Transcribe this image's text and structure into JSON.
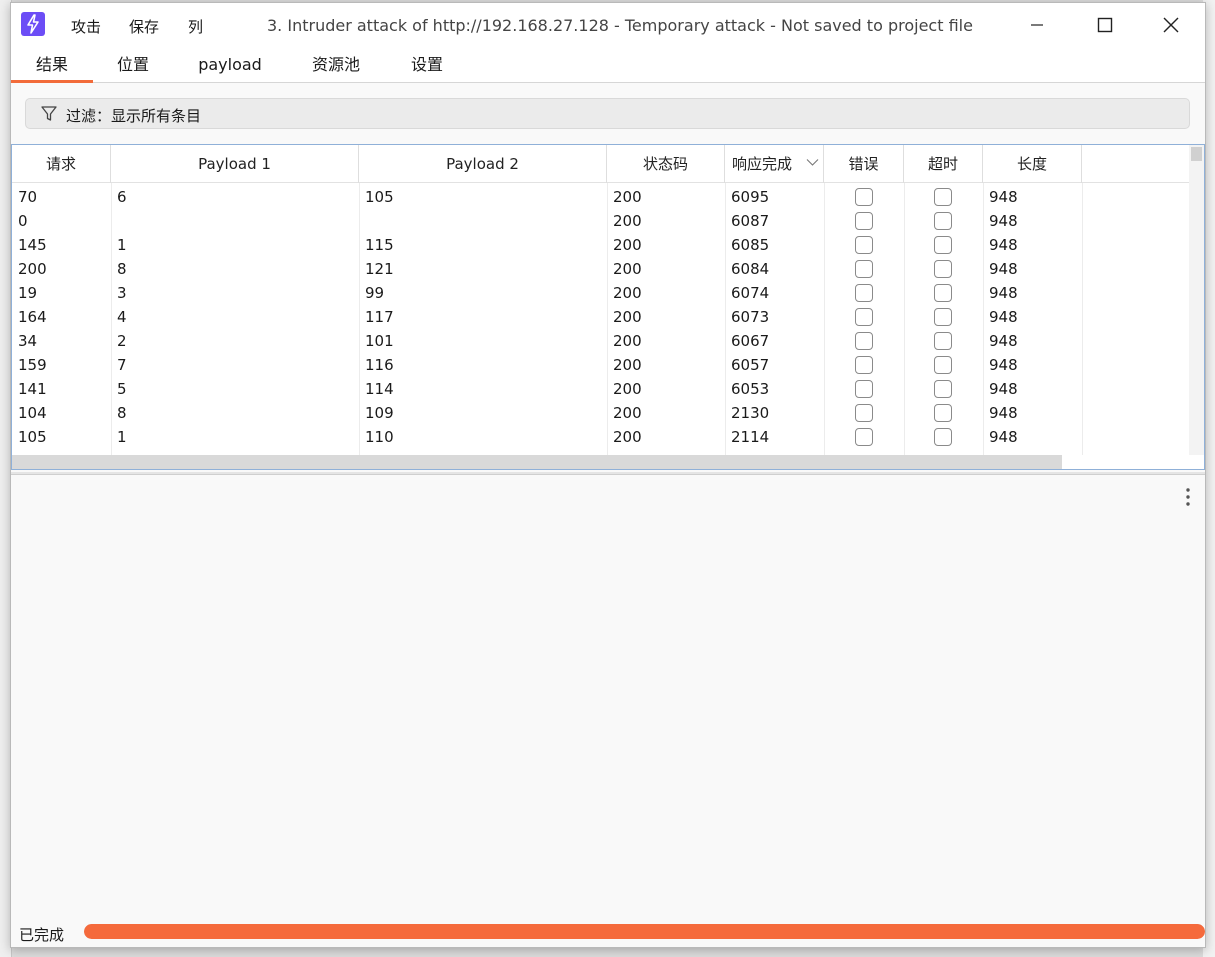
{
  "window": {
    "title": "3. Intruder attack of http://192.168.27.128 - Temporary attack - Not saved to project file",
    "menus": [
      "攻击",
      "保存",
      "列"
    ]
  },
  "tabs": [
    {
      "label": "结果",
      "active": true
    },
    {
      "label": "位置",
      "active": false
    },
    {
      "label": "payload",
      "active": false
    },
    {
      "label": "资源池",
      "active": false
    },
    {
      "label": "设置",
      "active": false
    }
  ],
  "filter": {
    "label": "过滤：显示所有条目"
  },
  "table": {
    "columns": [
      "请求",
      "Payload 1",
      "Payload 2",
      "状态码",
      "响应完成",
      "错误",
      "超时",
      "长度"
    ],
    "sorted_column": "响应完成",
    "rows": [
      {
        "request": "70",
        "p1": "6",
        "p2": "105",
        "status": "200",
        "response": "6095",
        "error": false,
        "timeout": false,
        "length": "948"
      },
      {
        "request": "0",
        "p1": "",
        "p2": "",
        "status": "200",
        "response": "6087",
        "error": false,
        "timeout": false,
        "length": "948"
      },
      {
        "request": "145",
        "p1": "1",
        "p2": "115",
        "status": "200",
        "response": "6085",
        "error": false,
        "timeout": false,
        "length": "948"
      },
      {
        "request": "200",
        "p1": "8",
        "p2": "121",
        "status": "200",
        "response": "6084",
        "error": false,
        "timeout": false,
        "length": "948"
      },
      {
        "request": "19",
        "p1": "3",
        "p2": "99",
        "status": "200",
        "response": "6074",
        "error": false,
        "timeout": false,
        "length": "948"
      },
      {
        "request": "164",
        "p1": "4",
        "p2": "117",
        "status": "200",
        "response": "6073",
        "error": false,
        "timeout": false,
        "length": "948"
      },
      {
        "request": "34",
        "p1": "2",
        "p2": "101",
        "status": "200",
        "response": "6067",
        "error": false,
        "timeout": false,
        "length": "948"
      },
      {
        "request": "159",
        "p1": "7",
        "p2": "116",
        "status": "200",
        "response": "6057",
        "error": false,
        "timeout": false,
        "length": "948"
      },
      {
        "request": "141",
        "p1": "5",
        "p2": "114",
        "status": "200",
        "response": "6053",
        "error": false,
        "timeout": false,
        "length": "948"
      },
      {
        "request": "104",
        "p1": "8",
        "p2": "109",
        "status": "200",
        "response": "2130",
        "error": false,
        "timeout": false,
        "length": "948"
      },
      {
        "request": "105",
        "p1": "1",
        "p2": "110",
        "status": "200",
        "response": "2114",
        "error": false,
        "timeout": false,
        "length": "948"
      }
    ]
  },
  "status": {
    "label": "已完成",
    "progress": 1.0
  },
  "colors": {
    "accent": "#f56a3c",
    "logo": "#6c4df6"
  }
}
